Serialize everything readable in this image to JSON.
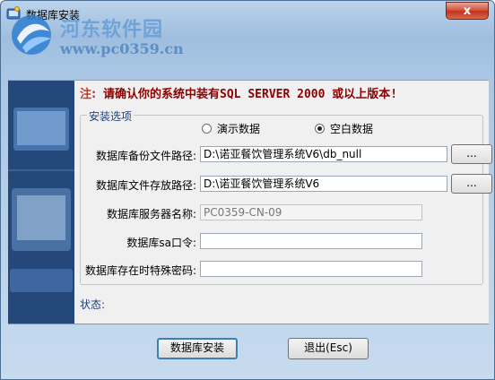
{
  "window": {
    "title": "数据库安装",
    "close_label": "x"
  },
  "watermark": {
    "line1": "河东软件园",
    "line2": "www.pc0359.cn"
  },
  "notice": {
    "lead": "注:",
    "text": "请确认你的系统中装有SQL SERVER 2000 或以上版本!"
  },
  "options": {
    "group_label": "安装选项",
    "radios": [
      {
        "label": "演示数据",
        "checked": false
      },
      {
        "label": "空白数据",
        "checked": true
      }
    ]
  },
  "fields": {
    "backup_path": {
      "label": "数据库备份文件路径:",
      "value": "D:\\诺亚餐饮管理系统V6\\db_null"
    },
    "store_path": {
      "label": "数据库文件存放路径:",
      "value": "D:\\诺亚餐饮管理系统V6"
    },
    "server_name": {
      "label": "数据库服务器名称:",
      "value": "PC0359-CN-09"
    },
    "sa_password": {
      "label": "数据库sa口令:",
      "value": ""
    },
    "special_password": {
      "label": "数据库存在时特殊密码:",
      "value": ""
    }
  },
  "browse_label": "...",
  "status_label": "状态:",
  "buttons": {
    "install": "数据库安装",
    "exit": "退出(Esc)"
  }
}
